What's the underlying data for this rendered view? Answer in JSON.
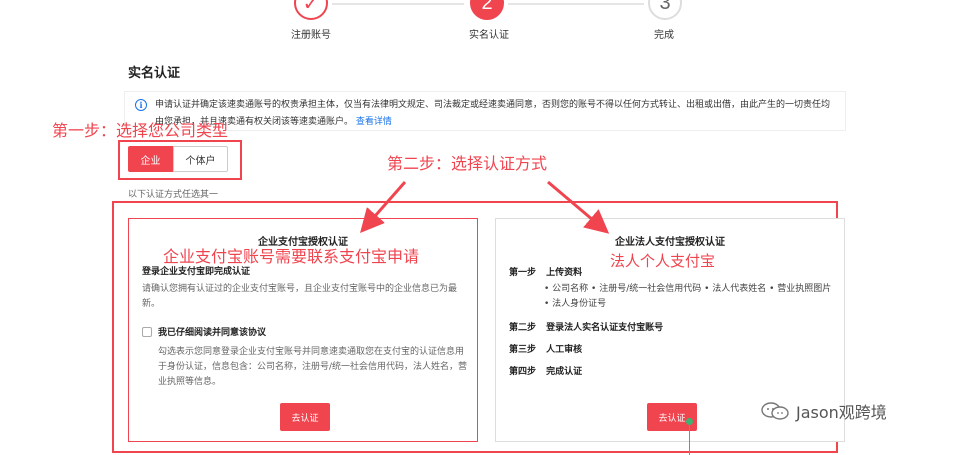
{
  "stepper": {
    "step1_icon": "check-icon",
    "step1_symbol": "✓",
    "step1_label": "注册账号",
    "step2_number": "2",
    "step2_label": "实名认证",
    "step3_number": "3",
    "step3_label": "完成"
  },
  "page_title": "实名认证",
  "notice": {
    "icon": "info-icon",
    "text": "申请认证并确定该速卖通账号的权责承担主体，仅当有法律明文规定、司法裁定或经速卖通同意，否则您的账号不得以任何方式转让、出租或出借，由此产生的一切责任均由您承担，并且速卖通有权关闭该等速卖通账户。",
    "link": "查看详情"
  },
  "annotations": {
    "step_one": "第一步：选择您公司类型",
    "step_two": "第二步：选择认证方式",
    "left_note": "企业支付宝账号需要联系支付宝申请",
    "right_note": "法人个人支付宝"
  },
  "company_type": {
    "options": [
      "企业",
      "个体户"
    ],
    "selected": "企业"
  },
  "choose_one_text": "以下认证方式任选其一",
  "left_card": {
    "title": "企业支付宝授权认证",
    "subtitle": "登录企业支付宝即完成认证",
    "description": "请确认您拥有认证过的企业支付宝账号，且企业支付宝账号中的企业信息已为最新。",
    "checkbox_label": "我已仔细阅读并同意该协议",
    "checkbox_checked": false,
    "checkbox_description": "勾选表示您同意登录企业支付宝账号并同意速卖通取您在支付宝的认证信息用于身份认证，信息包含：公司名称，注册号/统一社会信用代码，法人姓名，营业执照等信息。",
    "button": "去认证"
  },
  "right_card": {
    "title": "企业法人支付宝授权认证",
    "steps": [
      {
        "num": "第一步",
        "text": "上传资料"
      },
      {
        "num": "第二步",
        "text": "登录法人实名认证支付宝账号"
      },
      {
        "num": "第三步",
        "text": "人工审核"
      },
      {
        "num": "第四步",
        "text": "完成认证"
      }
    ],
    "upload_items": "• 公司名称  • 注册号/统一社会信用代码  • 法人代表姓名  • 营业执照图片  • 法人身份证号",
    "button": "去认证"
  },
  "watermark": {
    "icon": "wechat-icon",
    "text": "Jason观跨境"
  },
  "colors": {
    "accent": "#f0444f",
    "link": "#1a73e8",
    "green": "#3cb371"
  }
}
